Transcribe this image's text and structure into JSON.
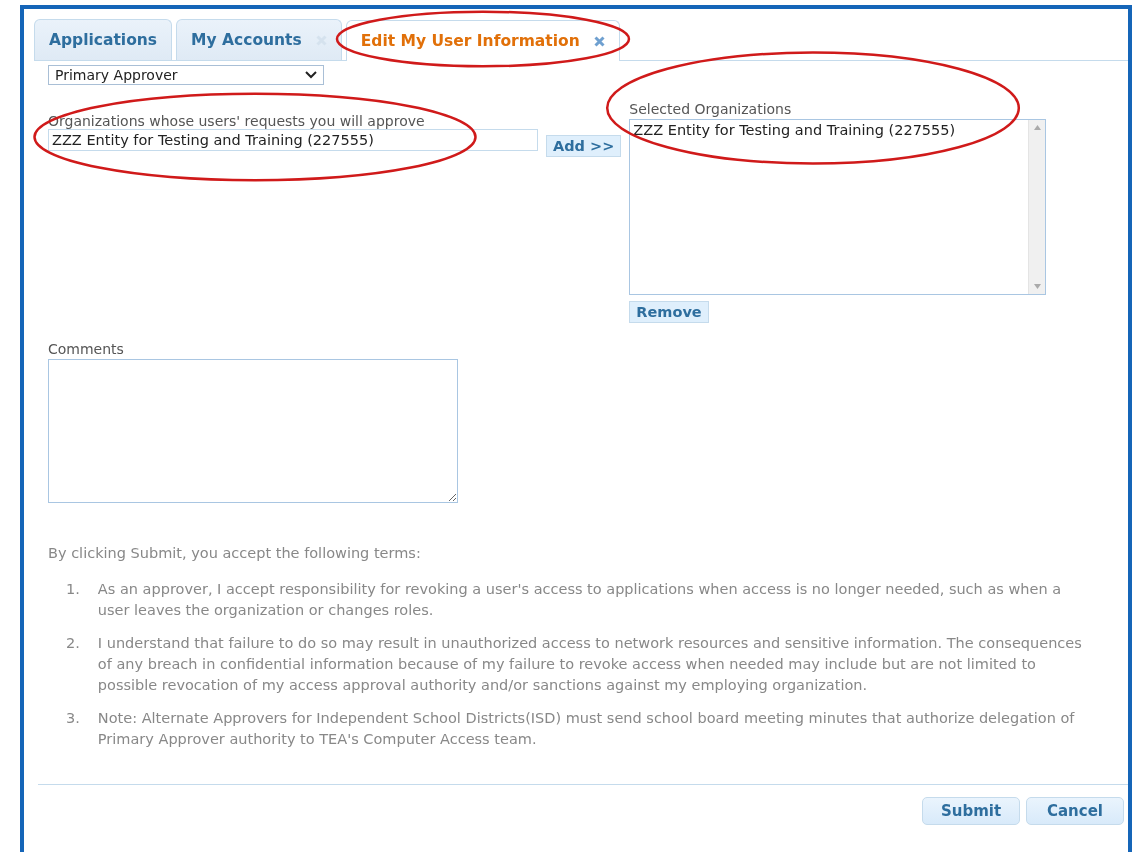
{
  "tabs": [
    {
      "label": "Applications",
      "selected": false,
      "closable": false,
      "circled": false
    },
    {
      "label": "My Accounts",
      "selected": false,
      "closable": true,
      "circled": false
    },
    {
      "label": "Edit My User Information",
      "selected": true,
      "closable": true,
      "circled": true
    }
  ],
  "approver_type": {
    "value": "Primary Approver"
  },
  "organizations": {
    "label": "Organizations whose users' requests you will approve",
    "value": "ZZZ Entity for Testing and Training (227555)",
    "circled": true,
    "add_button": "Add >>"
  },
  "selected_organizations": {
    "label": "Selected Organizations",
    "items": [
      "ZZZ Entity for Testing and Training (227555)"
    ],
    "circled": true,
    "remove_button": "Remove"
  },
  "comments": {
    "label": "Comments"
  },
  "terms": {
    "intro": "By clicking Submit, you accept the following terms:",
    "items": [
      {
        "number": "1.",
        "text": "As an approver, I accept responsibility for revoking a user's access to applications when access is no longer needed, such as when a user leaves the organization or changes roles."
      },
      {
        "number": "2.",
        "text": "I understand that failure to do so may result in unauthorized access to network resources and sensitive information. The consequences of any breach in confidential information because of my failure to revoke access when needed may include but are not limited to possible revocation of my access approval authority and/or sanctions against my employing organization."
      },
      {
        "number": "3.",
        "text": "Note: Alternate Approvers for Independent School Districts(ISD) must send school board meeting minutes that authorize delegation of Primary Approver authority to TEA's Computer Access team."
      }
    ]
  },
  "buttons": [
    "Submit",
    "Cancel"
  ]
}
